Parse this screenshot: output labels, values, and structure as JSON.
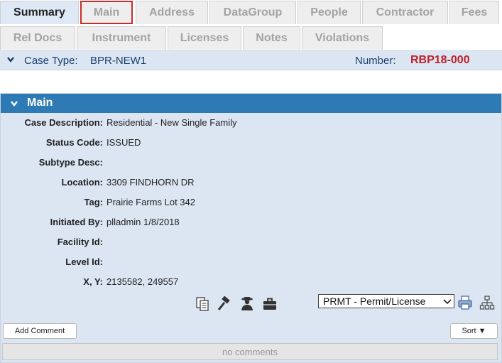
{
  "tabs_row1": [
    {
      "label": "Summary",
      "state": "active"
    },
    {
      "label": "Main",
      "state": "focused"
    },
    {
      "label": "Address",
      "state": "normal"
    },
    {
      "label": "DataGroup",
      "state": "normal"
    },
    {
      "label": "People",
      "state": "normal"
    },
    {
      "label": "Contractor",
      "state": "normal"
    },
    {
      "label": "Fees",
      "state": "normal"
    }
  ],
  "tabs_row2": [
    {
      "label": "Rel Docs"
    },
    {
      "label": "Instrument"
    },
    {
      "label": "Licenses"
    },
    {
      "label": "Notes"
    },
    {
      "label": "Violations"
    }
  ],
  "case_bar": {
    "case_type_label": "Case Type:",
    "case_type_value": "BPR-NEW1",
    "number_label": "Number:",
    "number_value": "RBP18-000"
  },
  "panel": {
    "title": "Main",
    "fields": [
      {
        "key": "Case Description:",
        "value": "Residential - New Single Family"
      },
      {
        "key": "Status Code:",
        "value": "ISSUED"
      },
      {
        "key": "Subtype Desc:",
        "value": ""
      },
      {
        "key": "Location:",
        "value": "3309 FINDHORN DR"
      },
      {
        "key": "Tag:",
        "value": "Prairie Farms Lot 342"
      },
      {
        "key": "Initiated By:",
        "value": "plladmin 1/8/2018"
      },
      {
        "key": "Facility Id:",
        "value": ""
      },
      {
        "key": "Level Id:",
        "value": ""
      },
      {
        "key": "X, Y:",
        "value": "2135582, 249557"
      }
    ]
  },
  "actions": {
    "icons": [
      "copy-icon",
      "gavel-icon",
      "inspector-icon",
      "briefcase-icon"
    ],
    "print_icon": "printer-icon",
    "tree_icon": "hierarchy-icon",
    "report_select_value": "PRMT - Permit/License"
  },
  "comments": {
    "add_label": "Add Comment",
    "sort_label": "Sort ▼",
    "empty_text": "no comments"
  },
  "colors": {
    "accent": "#2e7ab4",
    "panel_bg": "#dce5f2",
    "number_red": "#c0202a",
    "focus_border": "#cc2b2b"
  }
}
